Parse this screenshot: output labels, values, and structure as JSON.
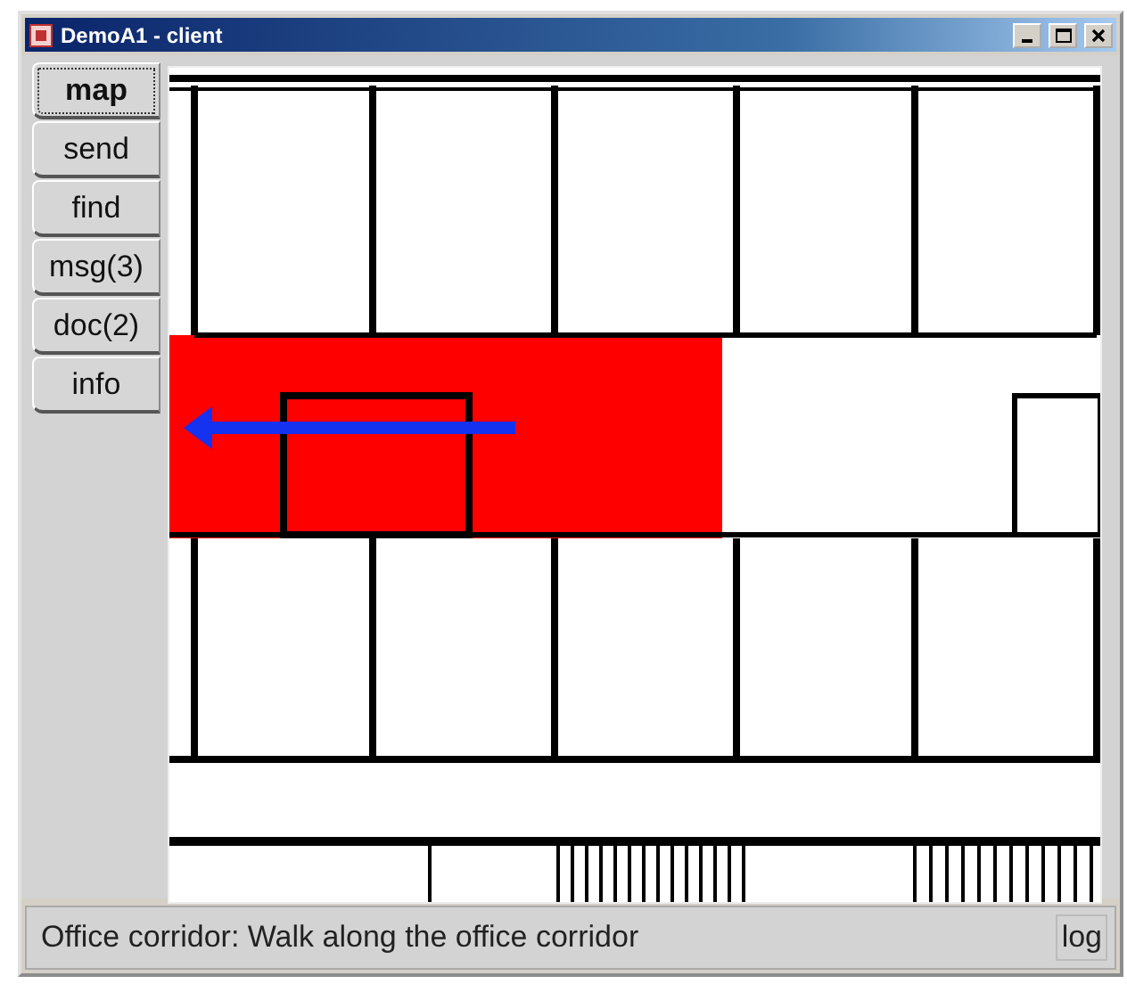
{
  "window": {
    "title": "DemoA1 - client"
  },
  "nav": [
    {
      "label": "map",
      "selected": true
    },
    {
      "label": "send",
      "selected": false
    },
    {
      "label": "find",
      "selected": false
    },
    {
      "label": "msg(3)",
      "selected": false
    },
    {
      "label": "doc(2)",
      "selected": false
    },
    {
      "label": "info",
      "selected": false
    }
  ],
  "status_bar": {
    "text": "Office corridor: Walk along the office corridor",
    "button": "log"
  }
}
